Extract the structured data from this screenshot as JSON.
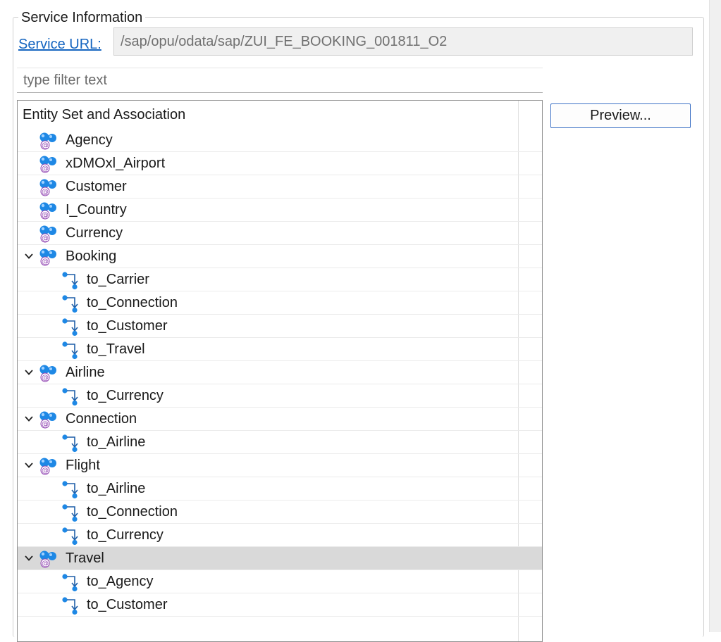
{
  "group": {
    "legend": "Service Information"
  },
  "service": {
    "label": "Service URL:",
    "value": "/sap/opu/odata/sap/ZUI_FE_BOOKING_001811_O2"
  },
  "filter": {
    "placeholder": "type filter text"
  },
  "tree": {
    "header": "Entity Set and Association",
    "rows": [
      {
        "label": "Agency",
        "type": "entity-set",
        "expanded": false
      },
      {
        "label": "xDMOxl_Airport",
        "type": "entity-set",
        "expanded": false
      },
      {
        "label": "Customer",
        "type": "entity-set",
        "expanded": false
      },
      {
        "label": "I_Country",
        "type": "entity-set",
        "expanded": false
      },
      {
        "label": "Currency",
        "type": "entity-set",
        "expanded": false
      },
      {
        "label": "Booking",
        "type": "entity-set",
        "expanded": true
      },
      {
        "label": "to_Carrier",
        "type": "association"
      },
      {
        "label": "to_Connection",
        "type": "association"
      },
      {
        "label": "to_Customer",
        "type": "association"
      },
      {
        "label": "to_Travel",
        "type": "association"
      },
      {
        "label": "Airline",
        "type": "entity-set",
        "expanded": true
      },
      {
        "label": "to_Currency",
        "type": "association"
      },
      {
        "label": "Connection",
        "type": "entity-set",
        "expanded": true
      },
      {
        "label": "to_Airline",
        "type": "association"
      },
      {
        "label": "Flight",
        "type": "entity-set",
        "expanded": true
      },
      {
        "label": "to_Airline",
        "type": "association"
      },
      {
        "label": "to_Connection",
        "type": "association"
      },
      {
        "label": "to_Currency",
        "type": "association"
      },
      {
        "label": "Travel",
        "type": "entity-set",
        "expanded": true,
        "selected": true
      },
      {
        "label": "to_Agency",
        "type": "association"
      },
      {
        "label": "to_Customer",
        "type": "association"
      }
    ]
  },
  "buttons": {
    "preview": "Preview..."
  },
  "colors": {
    "link": "#1565c0",
    "selection": "#d9d9d9",
    "entity_icon_blue": "#1e88e5",
    "entity_icon_at": "#8e3fb0",
    "button_border": "#3a6fc4"
  },
  "icons": {
    "entity-set": "entity-set-icon",
    "association": "association-icon",
    "expanded": "chevron-down-icon"
  }
}
